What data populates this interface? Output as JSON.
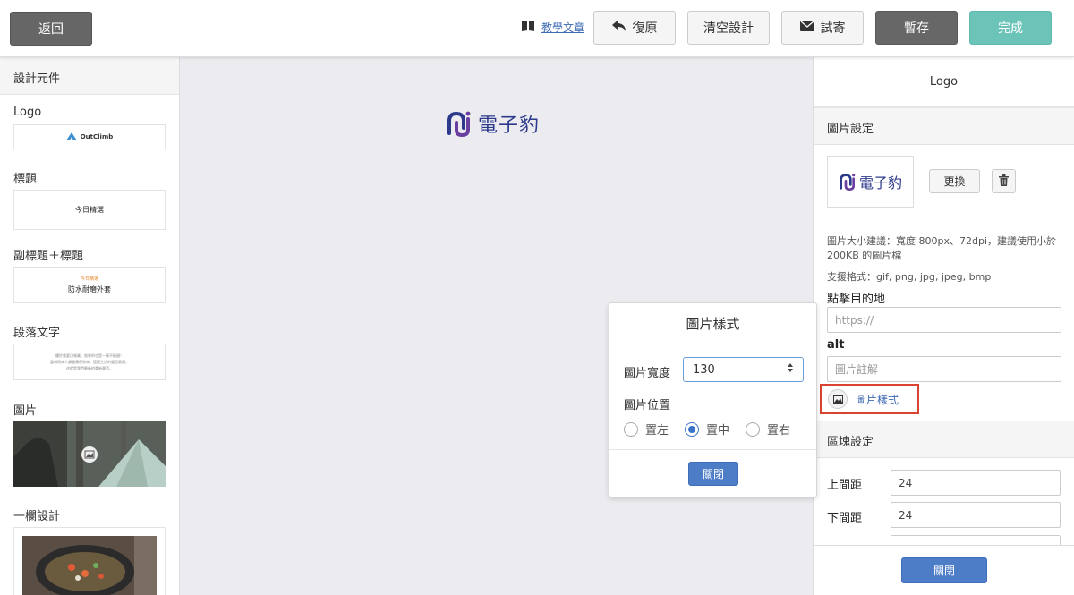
{
  "header": {
    "back_label": "返回",
    "tutorial_label": "教學文章",
    "undo_label": "復原",
    "clear_label": "清空設計",
    "test_send_label": "試寄",
    "save_label": "暫存",
    "done_label": "完成"
  },
  "components_panel": {
    "title": "設計元件",
    "items": [
      {
        "label": "Logo",
        "preview": "OutClimb"
      },
      {
        "label": "標題",
        "preview": "今日精選"
      },
      {
        "label": "副標題＋標題",
        "preview_sub": "今日精選",
        "preview": "防水耐磨外套"
      },
      {
        "label": "段落文字",
        "preview_lines": [
          "擺於重要日報業，效果的也是一條不斷鏈！",
          "重新再來人類健康便帶來，還還生活的聲音區隔，",
          "這就是我們最新的重新聲音。"
        ]
      },
      {
        "label": "圖片"
      },
      {
        "label": "一欄設計"
      }
    ]
  },
  "canvas": {
    "logo_text": "電子豹"
  },
  "image_style_popover": {
    "title": "圖片樣式",
    "width_label": "圖片寬度",
    "width_value": "130",
    "position_label": "圖片位置",
    "positions": [
      "置左",
      "置中",
      "置右"
    ],
    "selected_position": "置中",
    "close_label": "關閉"
  },
  "settings_panel": {
    "title": "Logo",
    "image_section": "圖片設定",
    "logo_text": "電子豹",
    "replace_label": "更換",
    "size_hint": "圖片大小建議：寬度 800px、72dpi，建議使用小於 200KB 的圖片檔",
    "format_hint": "支援格式：gif, png, jpg, jpeg, bmp",
    "link_label": "點擊目的地",
    "link_placeholder": "https://",
    "alt_label": "alt",
    "alt_placeholder": "圖片註解",
    "image_style_link": "圖片樣式",
    "block_section": "區塊設定",
    "top_padding_label": "上間距",
    "top_padding_value": "24",
    "bottom_padding_label": "下間距",
    "bottom_padding_value": "24",
    "close_label": "關閉"
  },
  "colors": {
    "accent_blue": "#4d7dc7",
    "done_teal": "#6cc4b9",
    "logo_navy": "#2d3a8c",
    "logo_purple": "#6b3fa0",
    "highlight_red": "#d9432f"
  }
}
